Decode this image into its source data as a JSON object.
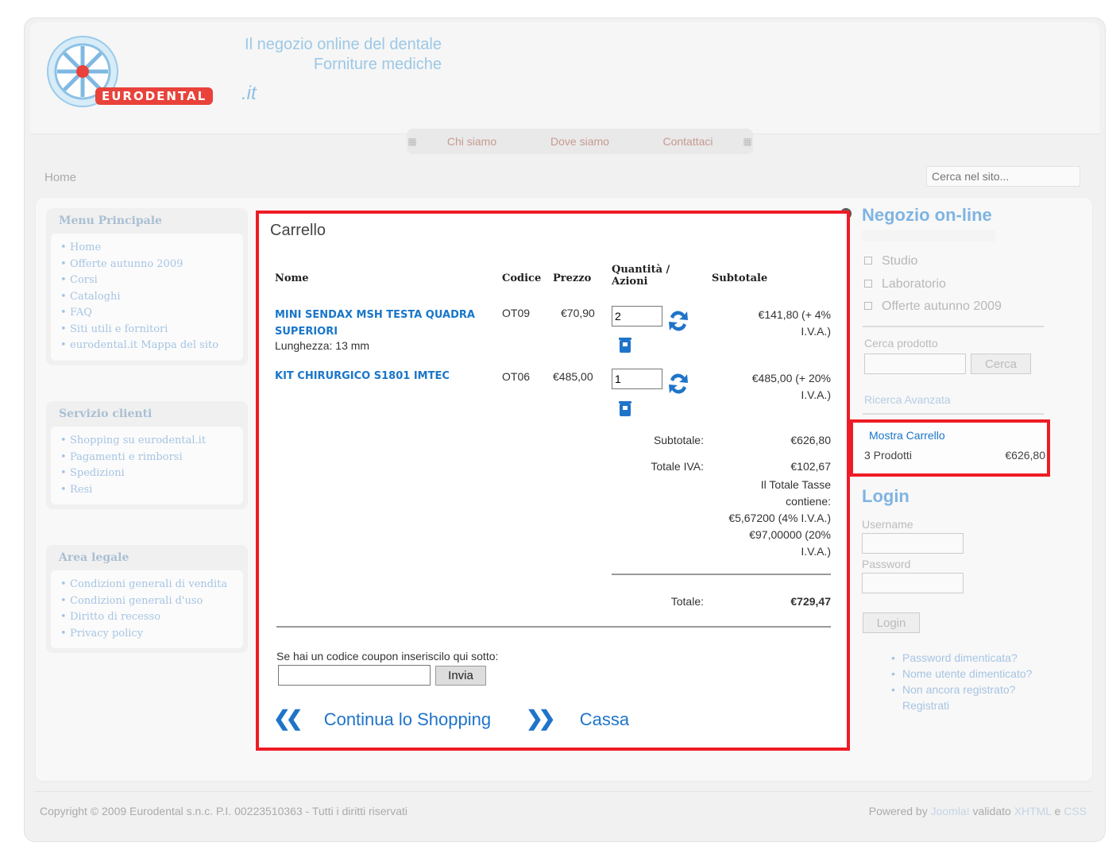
{
  "header": {
    "logo_text": "EURODENTAL",
    "logo_suffix": ".it",
    "tagline_1": "Il negozio online del dentale",
    "tagline_2": "Forniture mediche"
  },
  "topnav": [
    "Chi siamo",
    "Dove siamo",
    "Contattaci"
  ],
  "breadcrumb": "Home",
  "site_search": {
    "placeholder": "Cerca nel sito..."
  },
  "left": {
    "menu_principale": {
      "title": "Menu Principale",
      "items": [
        "Home",
        "Offerte autunno 2009",
        "Corsi",
        "Cataloghi",
        "FAQ",
        "Siti utili e fornitori",
        "eurodental.it Mappa del sito"
      ]
    },
    "servizio_clienti": {
      "title": "Servizio clienti",
      "items": [
        "Shopping su eurodental.it",
        "Pagamenti e rimborsi",
        "Spedizioni",
        "Resi"
      ]
    },
    "area_legale": {
      "title": "Area legale",
      "items": [
        "Condizioni generali di vendita",
        "Condizioni generali d'uso",
        "Diritto di recesso",
        "Privacy policy"
      ]
    }
  },
  "cart": {
    "title": "Carrello",
    "headers": {
      "nome": "Nome",
      "codice": "Codice",
      "prezzo": "Prezzo",
      "quantita_1": "Quantità /",
      "quantita_2": "Azioni",
      "subtotale": "Subtotale"
    },
    "items": [
      {
        "name_1": "MINI SENDAX MSH TESTA QUADRA",
        "name_2": "SUPERIORI",
        "detail": "Lunghezza: 13 mm",
        "code": "OT09",
        "price": "€70,90",
        "qty": "2",
        "subtotal_1": "€141,80 (+ 4%",
        "subtotal_2": "I.V.A.)"
      },
      {
        "name_1": "KIT CHIRURGICO S1801 IMTEC",
        "code": "OT06",
        "price": "€485,00",
        "qty": "1",
        "subtotal_1": "€485,00 (+ 20%",
        "subtotal_2": "I.V.A.)"
      }
    ],
    "summary": {
      "subtotale_label": "Subtotale:",
      "subtotale_value": "€626,80",
      "iva_label": "Totale IVA:",
      "iva_value": "€102,67",
      "tasse_1": "Il Totale Tasse",
      "tasse_2": "contiene:",
      "tasse_3": "€5,67200 (4% I.V.A.)",
      "tasse_4": "€97,00000 (20%",
      "tasse_5": "I.V.A.)",
      "totale_label": "Totale:",
      "totale_value": "€729,47"
    },
    "coupon_prompt": "Se hai un codice coupon inseriscilo qui sotto:",
    "coupon_button": "Invia",
    "continue_label": "Continua lo Shopping",
    "checkout_label": "Cassa"
  },
  "right": {
    "shop_title": "Negozio on-line",
    "categories": [
      "Studio",
      "Laboratorio",
      "Offerte autunno 2009"
    ],
    "search_label": "Cerca prodotto",
    "search_button": "Cerca",
    "advanced_search": "Ricerca Avanzata",
    "cart_link": "Mostra Carrello",
    "cart_count": "3 Prodotti",
    "cart_total": "€626,80",
    "login_title": "Login",
    "username_label": "Username",
    "password_label": "Password",
    "login_button": "Login",
    "login_links": [
      "Password dimenticata?",
      "Nome utente dimenticato?",
      "Non ancora registrato? Registrati"
    ]
  },
  "footer": {
    "copyright": "Copyright © 2009 Eurodental s.n.c. P.I. 00223510363 - Tutti i diritti riservati",
    "powered_prefix": "Powered by",
    "powered_joomla": "Joomla!",
    "powered_mid": "validato",
    "powered_xhtml": "XHTML",
    "powered_and": "e",
    "powered_css": "CSS"
  },
  "colors": {
    "highlight_border": "#ee1c25",
    "link_blue": "#1976c9",
    "faded_link": "#a6c4e3"
  }
}
